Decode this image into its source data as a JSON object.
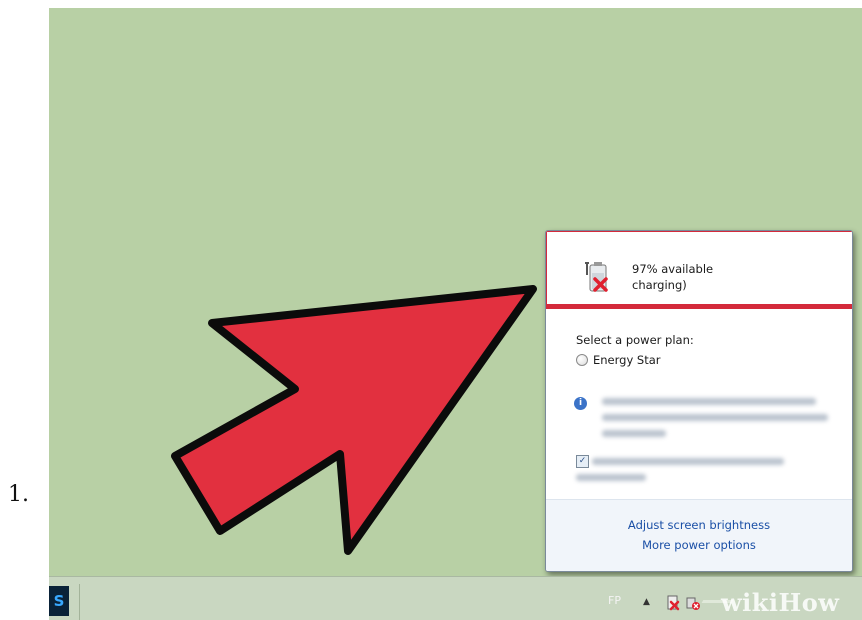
{
  "step": {
    "number": "1."
  },
  "battery": {
    "status_line1": "97% available",
    "status_line2": "charging)",
    "icon": "battery-plug-error-icon"
  },
  "power_plan": {
    "title": "Select a power plan:",
    "options": [
      {
        "label": "Energy Star",
        "selected": false
      }
    ]
  },
  "footer": {
    "link1": "Adjust screen brightness",
    "link2": "More power options"
  },
  "taskbar": {
    "app_icon_label": "S",
    "tray_label": "FP",
    "tray_expand": "▲"
  },
  "watermark": {
    "text_wiki": "wiki",
    "text_how": "How"
  },
  "colors": {
    "desktop": "#b8d0a5",
    "arrow": "#e2303f",
    "highlight": "#d42a3b",
    "link": "#1a4fa6"
  }
}
